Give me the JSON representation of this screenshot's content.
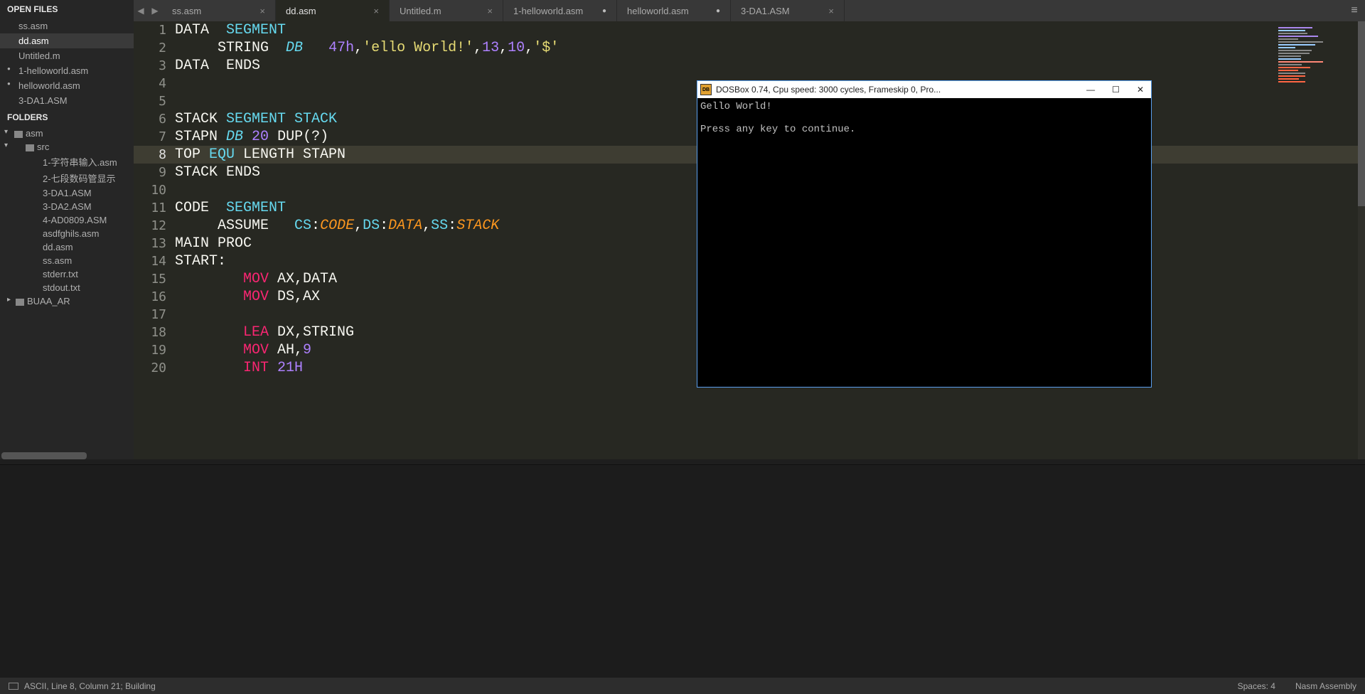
{
  "sidebar": {
    "openFilesHeader": "OPEN FILES",
    "foldersHeader": "FOLDERS",
    "openFiles": [
      {
        "name": "ss.asm",
        "dirty": false
      },
      {
        "name": "dd.asm",
        "dirty": false,
        "selected": true
      },
      {
        "name": "Untitled.m",
        "dirty": false
      },
      {
        "name": "1-helloworld.asm",
        "dirty": true
      },
      {
        "name": "helloworld.asm",
        "dirty": true
      },
      {
        "name": "3-DA1.ASM",
        "dirty": false
      }
    ],
    "rootFolder": "asm",
    "srcFolder": "src",
    "srcFiles": [
      "1-字符串输入.asm",
      "2-七段数码管显示",
      "3-DA1.ASM",
      "3-DA2.ASM",
      "4-AD0809.ASM",
      "asdfghils.asm",
      "dd.asm",
      "ss.asm",
      "stderr.txt",
      "stdout.txt"
    ],
    "folder2": "BUAA_AR"
  },
  "tabs": [
    {
      "label": "ss.asm",
      "close": "×",
      "dirty": false
    },
    {
      "label": "dd.asm",
      "close": "×",
      "dirty": false,
      "active": true
    },
    {
      "label": "Untitled.m",
      "close": "×",
      "dirty": false
    },
    {
      "label": "1-helloworld.asm",
      "close": "●",
      "dirty": true
    },
    {
      "label": "helloworld.asm",
      "close": "●",
      "dirty": true
    },
    {
      "label": "3-DA1.ASM",
      "close": "×",
      "dirty": false
    }
  ],
  "code": {
    "currentLine": 8,
    "lines": [
      [
        {
          "t": "DATA  ",
          "c": "c-white"
        },
        {
          "t": "SEGMENT",
          "c": "c-cyan2"
        }
      ],
      [
        {
          "t": "     STRING  ",
          "c": "c-white"
        },
        {
          "t": "DB",
          "c": "c-cyan"
        },
        {
          "t": "   ",
          "c": "c-white"
        },
        {
          "t": "47h",
          "c": "c-num"
        },
        {
          "t": ",",
          "c": "c-white"
        },
        {
          "t": "'ello World!'",
          "c": "c-str"
        },
        {
          "t": ",",
          "c": "c-white"
        },
        {
          "t": "13",
          "c": "c-num"
        },
        {
          "t": ",",
          "c": "c-white"
        },
        {
          "t": "10",
          "c": "c-num"
        },
        {
          "t": ",",
          "c": "c-white"
        },
        {
          "t": "'$'",
          "c": "c-str"
        }
      ],
      [
        {
          "t": "DATA  ENDS",
          "c": "c-white"
        }
      ],
      [],
      [],
      [
        {
          "t": "STACK ",
          "c": "c-white"
        },
        {
          "t": "SEGMENT",
          "c": "c-cyan2"
        },
        {
          "t": " STACK",
          "c": "c-cyan2"
        }
      ],
      [
        {
          "t": "STAPN ",
          "c": "c-white"
        },
        {
          "t": "DB",
          "c": "c-cyan"
        },
        {
          "t": " ",
          "c": "c-white"
        },
        {
          "t": "20",
          "c": "c-num"
        },
        {
          "t": " DUP(?)",
          "c": "c-white"
        }
      ],
      [
        {
          "t": "TOP ",
          "c": "c-white"
        },
        {
          "t": "EQU",
          "c": "c-cyan2"
        },
        {
          "t": " LENGTH STAPN",
          "c": "c-white"
        }
      ],
      [
        {
          "t": "STACK ENDS",
          "c": "c-white"
        }
      ],
      [],
      [
        {
          "t": "CODE  ",
          "c": "c-white"
        },
        {
          "t": "SEGMENT",
          "c": "c-cyan2"
        }
      ],
      [
        {
          "t": "     ASSUME   ",
          "c": "c-white"
        },
        {
          "t": "CS",
          "c": "c-cyan2"
        },
        {
          "t": ":",
          "c": "c-white"
        },
        {
          "t": "CODE",
          "c": "c-orange"
        },
        {
          "t": ",",
          "c": "c-white"
        },
        {
          "t": "DS",
          "c": "c-cyan2"
        },
        {
          "t": ":",
          "c": "c-white"
        },
        {
          "t": "DATA",
          "c": "c-orange"
        },
        {
          "t": ",",
          "c": "c-white"
        },
        {
          "t": "SS",
          "c": "c-cyan2"
        },
        {
          "t": ":",
          "c": "c-white"
        },
        {
          "t": "STACK",
          "c": "c-orange"
        }
      ],
      [
        {
          "t": "MAIN PROC",
          "c": "c-white"
        }
      ],
      [
        {
          "t": "START:",
          "c": "c-white"
        }
      ],
      [
        {
          "t": "        ",
          "c": "c-white"
        },
        {
          "t": "MOV",
          "c": "c-kw"
        },
        {
          "t": " AX,DATA",
          "c": "c-white"
        }
      ],
      [
        {
          "t": "        ",
          "c": "c-white"
        },
        {
          "t": "MOV",
          "c": "c-kw"
        },
        {
          "t": " DS,AX",
          "c": "c-white"
        }
      ],
      [],
      [
        {
          "t": "        ",
          "c": "c-white"
        },
        {
          "t": "LEA",
          "c": "c-kw"
        },
        {
          "t": " DX,STRING",
          "c": "c-white"
        }
      ],
      [
        {
          "t": "        ",
          "c": "c-white"
        },
        {
          "t": "MOV",
          "c": "c-kw"
        },
        {
          "t": " AH,",
          "c": "c-white"
        },
        {
          "t": "9",
          "c": "c-num"
        }
      ],
      [
        {
          "t": "        ",
          "c": "c-white"
        },
        {
          "t": "INT",
          "c": "c-kw"
        },
        {
          "t": " ",
          "c": "c-white"
        },
        {
          "t": "21H",
          "c": "c-num"
        }
      ]
    ]
  },
  "dosbox": {
    "title": "DOSBox 0.74, Cpu speed:     3000 cycles, Frameskip  0, Pro...",
    "line1": "Gello World!",
    "line2": "Press any key to continue."
  },
  "status": {
    "left": "ASCII, Line 8, Column 21; Building",
    "spaces": "Spaces: 4",
    "syntax": "Nasm Assembly"
  }
}
